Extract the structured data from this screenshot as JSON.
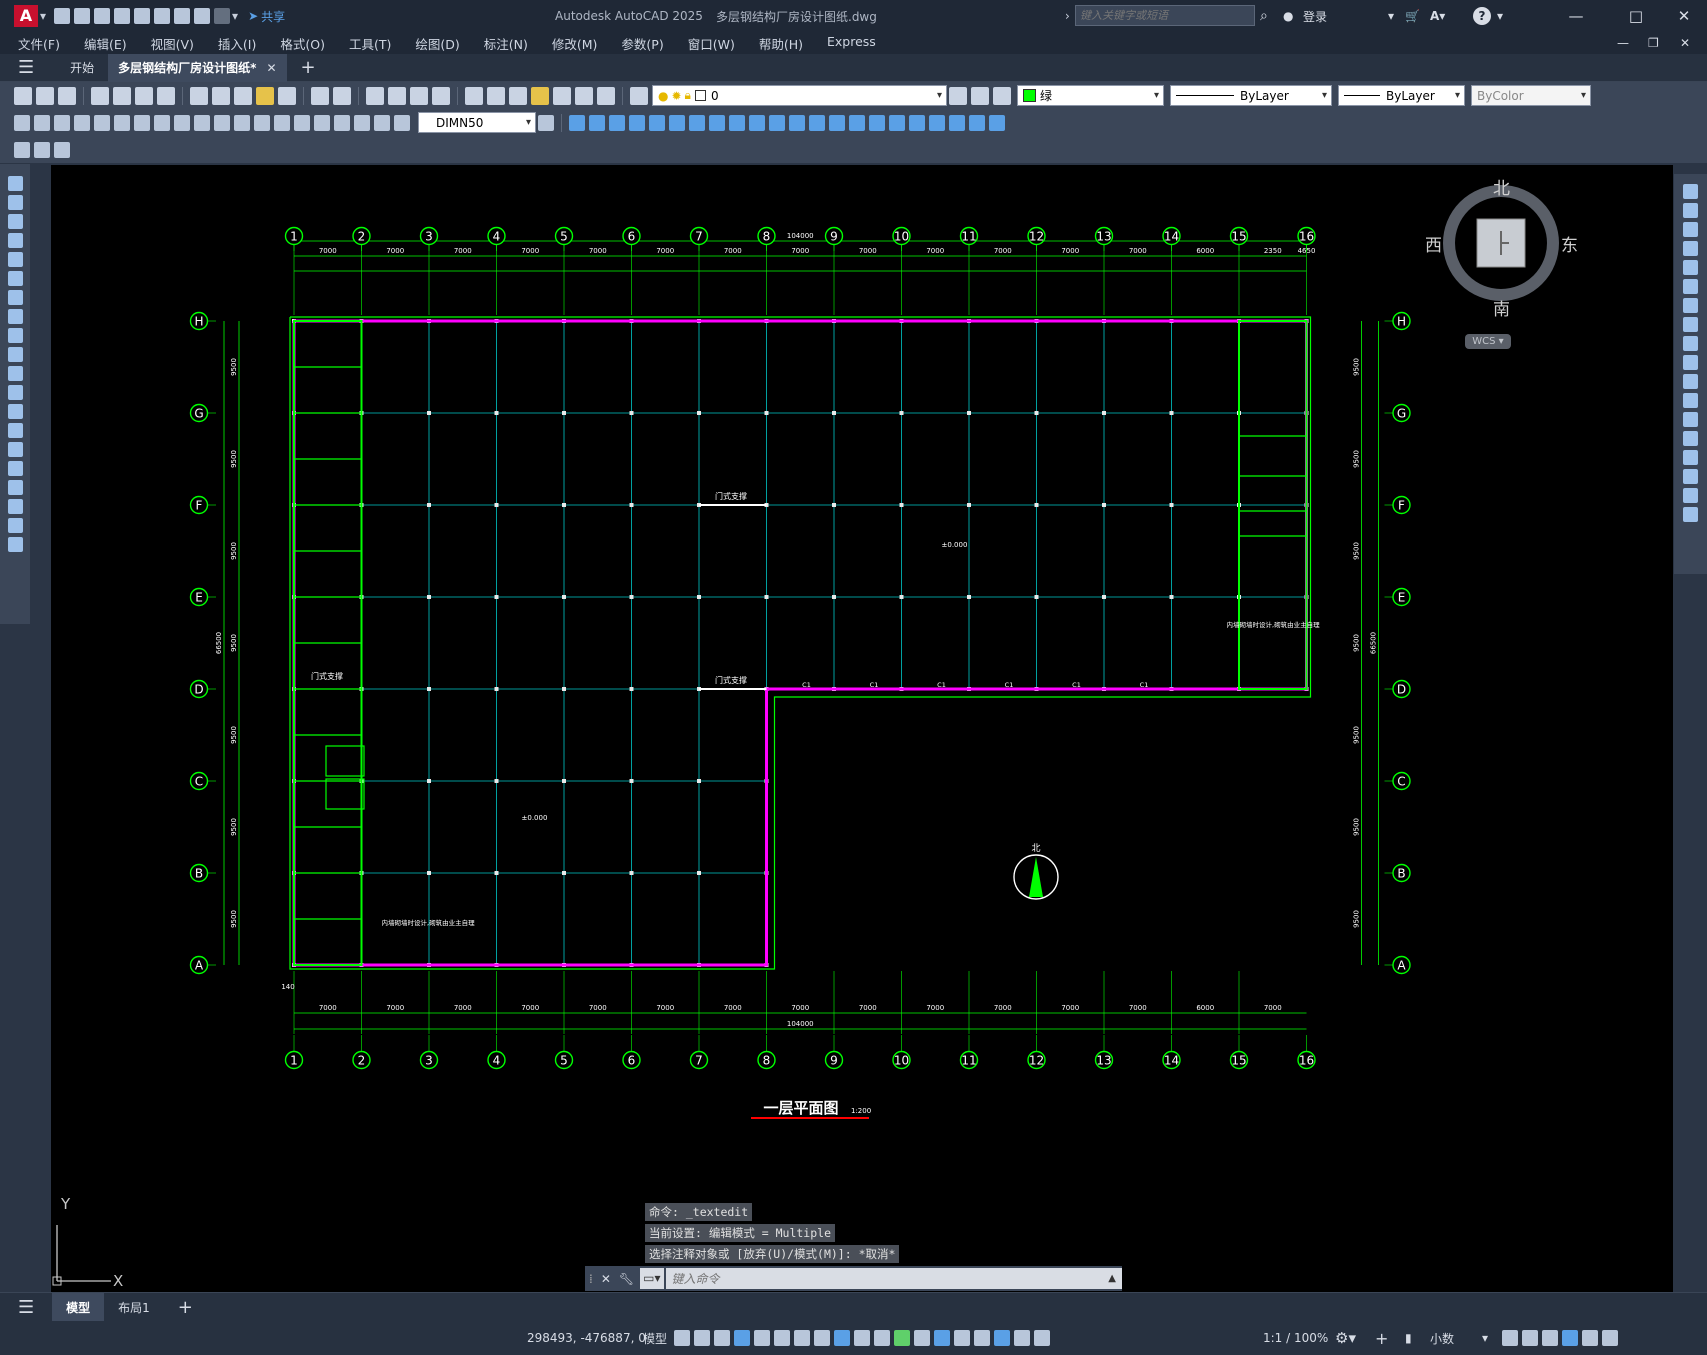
{
  "app": {
    "title": "Autodesk AutoCAD 2025",
    "file": "多层钢结构厂房设计图纸.dwg",
    "share": "共享",
    "search_placeholder": "键入关键字或短语",
    "login": "登录",
    "logo": "A"
  },
  "menu": [
    "文件(F)",
    "编辑(E)",
    "视图(V)",
    "插入(I)",
    "格式(O)",
    "工具(T)",
    "绘图(D)",
    "标注(N)",
    "修改(M)",
    "参数(P)",
    "窗口(W)",
    "帮助(H)",
    "Express"
  ],
  "tabs": {
    "start": "开始",
    "doc": "多层钢结构厂房设计图纸*",
    "add": "+"
  },
  "toolbar": {
    "layer": "0",
    "color": "绿",
    "linetype": "ByLayer",
    "lineweight": "ByLayer",
    "plotstyle": "ByColor",
    "dimstyle": "DIMN50"
  },
  "viewcube": {
    "north": "北",
    "south": "南",
    "east": "东",
    "west": "西",
    "top": "上",
    "wcs": "WCS"
  },
  "ucs": {
    "x": "X",
    "y": "Y"
  },
  "drawing": {
    "col_labels": [
      "1",
      "2",
      "3",
      "4",
      "5",
      "6",
      "7",
      "8",
      "9",
      "10",
      "11",
      "12",
      "13",
      "14",
      "15",
      "16"
    ],
    "row_labels": [
      "H",
      "G",
      "F",
      "E",
      "D",
      "C",
      "B",
      "A"
    ],
    "title": "一层平面图",
    "scale": "1:200",
    "total_dim": "104000",
    "total_dim_y": "66500",
    "top_dims": [
      "7000",
      "7000",
      "7000",
      "7000",
      "7000",
      "7000",
      "7000",
      "7000",
      "7000",
      "7000",
      "7000",
      "7000",
      "7000",
      "6000",
      "2350",
      "4650"
    ],
    "bottom_dims": [
      "7000",
      "7000",
      "7000",
      "7000",
      "7000",
      "7000",
      "7000",
      "7000",
      "7000",
      "7000",
      "7000",
      "7000",
      "7000",
      "6000",
      "7000"
    ],
    "row_dims": [
      "9500",
      "9500",
      "9500",
      "9500",
      "9500",
      "9500",
      "9500"
    ],
    "elev1": "±0.000",
    "elev2": "±0.000",
    "brace1": "门式支撑",
    "brace2": "门式支撑",
    "brace3": "门式支撑",
    "note": "内墙砌墙时设计,砌筑由业主自理",
    "window": "C1",
    "tag140": "140",
    "north": "北"
  },
  "command": {
    "history": [
      "命令: _textedit",
      "当前设置: 编辑模式 = Multiple",
      "选择注释对象或 [放弃(U)/模式(M)]: *取消*"
    ],
    "placeholder": "键入命令"
  },
  "layouts": {
    "model": "模型",
    "layout1": "布局1",
    "add": "+"
  },
  "status": {
    "coords": "298493, -476887, 0",
    "model": "模型",
    "scale": "1:1 / 100%",
    "units": "小数"
  }
}
